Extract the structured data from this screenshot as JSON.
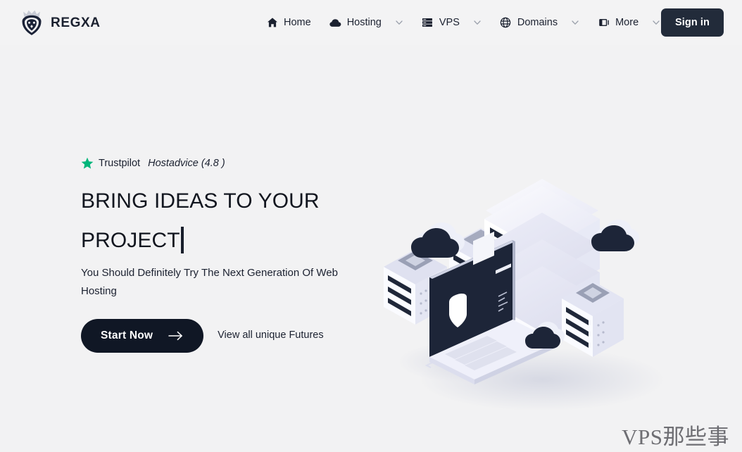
{
  "header": {
    "brand": {
      "name": "REGXA",
      "logo_icon": "lion-crown-icon"
    },
    "nav": [
      {
        "label": "Home",
        "icon": "home-icon",
        "has_dropdown": false
      },
      {
        "label": "Hosting",
        "icon": "cloud-icon",
        "has_dropdown": true
      },
      {
        "label": "VPS",
        "icon": "server-icon",
        "has_dropdown": true
      },
      {
        "label": "Domains",
        "icon": "globe-icon",
        "has_dropdown": true
      },
      {
        "label": "More",
        "icon": "panel-icon",
        "has_dropdown": true
      }
    ],
    "signin_label": "Sign in"
  },
  "hero": {
    "rating": {
      "star_icon": "star-icon",
      "star_color": "#00b67a",
      "trustpilot": "Trustpilot",
      "hostadvice": "Hostadvice (4.8 )"
    },
    "headline": "BRING IDEAS TO YOUR PROJECT",
    "subhead": "You Should Definitely Try The Next Generation Of Web Hosting",
    "cta_primary": "Start Now",
    "cta_primary_icon": "arrow-right-icon",
    "cta_secondary": "View all unique Futures",
    "illustration_name": "isometric-server-laptop-cloud-illustration"
  },
  "watermark": "VPS那些事",
  "colors": {
    "page_background": "#f2f2f3",
    "dark": "#101725",
    "signin_background": "#222b3a",
    "accent_green": "#00b67a",
    "text": "#1b2130"
  }
}
